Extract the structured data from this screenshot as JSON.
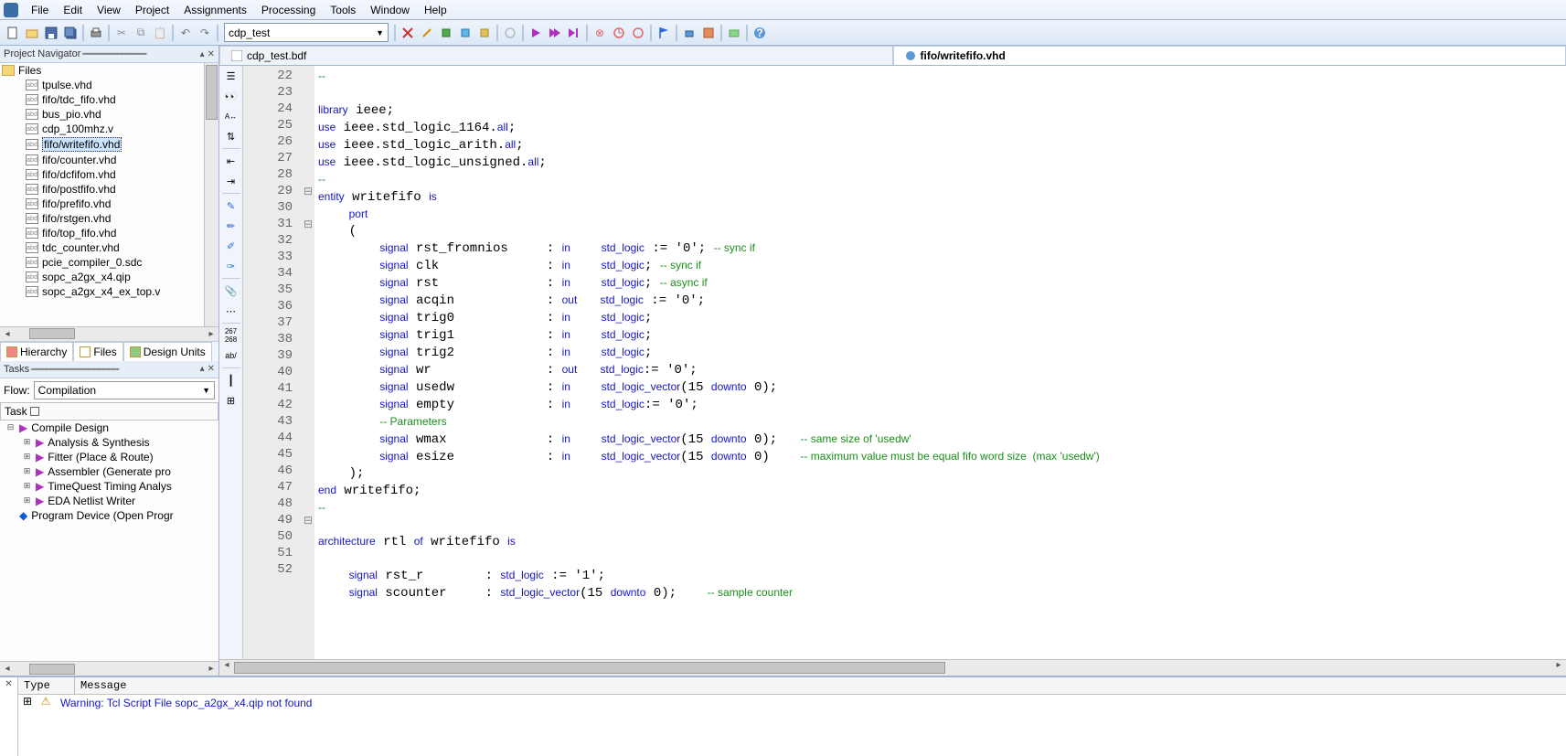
{
  "menu": {
    "items": [
      "File",
      "Edit",
      "View",
      "Project",
      "Assignments",
      "Processing",
      "Tools",
      "Window",
      "Help"
    ]
  },
  "toolbar": {
    "project_sel": "cdp_test"
  },
  "navigator": {
    "title": "Project Navigator",
    "root": "Files",
    "files": [
      "tpulse.vhd",
      "fifo/tdc_fifo.vhd",
      "bus_pio.vhd",
      "cdp_100mhz.v",
      "fifo/writefifo.vhd",
      "fifo/counter.vhd",
      "fifo/dcfifom.vhd",
      "fifo/postfifo.vhd",
      "fifo/prefifo.vhd",
      "fifo/rstgen.vhd",
      "fifo/top_fifo.vhd",
      "tdc_counter.vhd",
      "pcie_compiler_0.sdc",
      "sopc_a2gx_x4.qip",
      "sopc_a2gx_x4_ex_top.v"
    ],
    "selected": "fifo/writefifo.vhd",
    "tabs": [
      "Hierarchy",
      "Files",
      "Design Units"
    ]
  },
  "tasks": {
    "title": "Tasks",
    "flow_label": "Flow:",
    "flow_value": "Compilation",
    "task_header": "Task",
    "tree": [
      {
        "label": "Compile Design",
        "indent": 0,
        "color": "purple",
        "exp": "⊟"
      },
      {
        "label": "Analysis & Synthesis",
        "indent": 1,
        "color": "purple",
        "exp": "⊞"
      },
      {
        "label": "Fitter (Place & Route)",
        "indent": 1,
        "color": "purple",
        "exp": "⊞"
      },
      {
        "label": "Assembler (Generate pro",
        "indent": 1,
        "color": "purple",
        "exp": "⊞"
      },
      {
        "label": "TimeQuest Timing Analys",
        "indent": 1,
        "color": "purple",
        "exp": "⊞"
      },
      {
        "label": "EDA Netlist Writer",
        "indent": 1,
        "color": "purple",
        "exp": "⊞"
      },
      {
        "label": "Program Device (Open Progr",
        "indent": 0,
        "color": "blue",
        "exp": ""
      }
    ]
  },
  "editor": {
    "tabs": [
      {
        "label": "cdp_test.bdf",
        "active": false,
        "icon": "bdf"
      },
      {
        "label": "fifo/writefifo.vhd",
        "active": true,
        "icon": "vhd"
      }
    ],
    "lines": [
      {
        "n": 22,
        "f": "",
        "h": "<span class='cmt'>--</span>"
      },
      {
        "n": 23,
        "f": "",
        "h": ""
      },
      {
        "n": 24,
        "f": "",
        "h": "<span class='kw'>library</span> ieee;"
      },
      {
        "n": 25,
        "f": "",
        "h": "<span class='kw'>use</span> ieee.std_logic_1164.<span class='kw'>all</span>;"
      },
      {
        "n": 26,
        "f": "",
        "h": "<span class='kw'>use</span> ieee.std_logic_arith.<span class='kw'>all</span>;"
      },
      {
        "n": 27,
        "f": "",
        "h": "<span class='kw'>use</span> ieee.std_logic_unsigned.<span class='kw'>all</span>;"
      },
      {
        "n": 28,
        "f": "",
        "h": "<span class='cmt'>--</span>"
      },
      {
        "n": 29,
        "f": "⊟",
        "h": "<span class='kw'>entity</span> writefifo <span class='kw'>is</span>"
      },
      {
        "n": 30,
        "f": "",
        "h": "    <span class='kw'>port</span>"
      },
      {
        "n": 31,
        "f": "⊟",
        "h": "    ("
      },
      {
        "n": 32,
        "f": "",
        "h": "        <span class='kw'>signal</span> rst_fromnios     : <span class='kw'>in</span>    <span class='typ'>std_logic</span> := '0'; <span class='cmt'>-- sync if</span>"
      },
      {
        "n": 33,
        "f": "",
        "h": "        <span class='kw'>signal</span> clk              : <span class='kw'>in</span>    <span class='typ'>std_logic</span>; <span class='cmt'>-- sync if</span>"
      },
      {
        "n": 34,
        "f": "",
        "h": "        <span class='kw'>signal</span> rst              : <span class='kw'>in</span>    <span class='typ'>std_logic</span>; <span class='cmt'>-- async if</span>"
      },
      {
        "n": 35,
        "f": "",
        "h": "        <span class='kw'>signal</span> acqin            : <span class='kw'>out</span>   <span class='typ'>std_logic</span> := '0';"
      },
      {
        "n": 36,
        "f": "",
        "h": "        <span class='kw'>signal</span> trig0            : <span class='kw'>in</span>    <span class='typ'>std_logic</span>;"
      },
      {
        "n": 37,
        "f": "",
        "h": "        <span class='kw'>signal</span> trig1            : <span class='kw'>in</span>    <span class='typ'>std_logic</span>;"
      },
      {
        "n": 38,
        "f": "",
        "h": "        <span class='kw'>signal</span> trig2            : <span class='kw'>in</span>    <span class='typ'>std_logic</span>;"
      },
      {
        "n": 39,
        "f": "",
        "h": "        <span class='kw'>signal</span> wr               : <span class='kw'>out</span>   <span class='typ'>std_logic</span>:= '0';"
      },
      {
        "n": 40,
        "f": "",
        "h": "        <span class='kw'>signal</span> usedw            : <span class='kw'>in</span>    <span class='typ'>std_logic_vector</span>(15 <span class='kw'>downto</span> 0);"
      },
      {
        "n": 41,
        "f": "",
        "h": "        <span class='kw'>signal</span> empty            : <span class='kw'>in</span>    <span class='typ'>std_logic</span>:= '0';"
      },
      {
        "n": 42,
        "f": "",
        "h": "        <span class='cmt'>-- Parameters</span>"
      },
      {
        "n": 43,
        "f": "",
        "h": "        <span class='kw'>signal</span> wmax             : <span class='kw'>in</span>    <span class='typ'>std_logic_vector</span>(15 <span class='kw'>downto</span> 0);   <span class='cmt'>-- same size of 'usedw'</span>"
      },
      {
        "n": 44,
        "f": "",
        "h": "        <span class='kw'>signal</span> esize            : <span class='kw'>in</span>    <span class='typ'>std_logic_vector</span>(15 <span class='kw'>downto</span> 0)    <span class='cmt'>-- maximum value must be equal fifo word size  (max 'usedw')</span>"
      },
      {
        "n": 45,
        "f": "",
        "h": "    );"
      },
      {
        "n": 46,
        "f": "",
        "h": "<span class='kw'>end</span> writefifo;"
      },
      {
        "n": 47,
        "f": "",
        "h": "<span class='cmt'>--</span>"
      },
      {
        "n": 48,
        "f": "",
        "h": ""
      },
      {
        "n": 49,
        "f": "⊟",
        "h": "<span class='kw'>architecture</span> rtl <span class='kw'>of</span> writefifo <span class='kw'>is</span>"
      },
      {
        "n": 50,
        "f": "",
        "h": ""
      },
      {
        "n": 51,
        "f": "",
        "h": "    <span class='kw'>signal</span> rst_r        : <span class='typ'>std_logic</span> := '1';"
      },
      {
        "n": 52,
        "f": "",
        "h": "    <span class='kw'>signal</span> scounter     : <span class='typ'>std_logic_vector</span>(15 <span class='kw'>downto</span> 0);    <span class='cmt'>-- sample counter</span>"
      }
    ]
  },
  "messages": {
    "head_type": "Type",
    "head_msg": "Message",
    "rows": [
      {
        "icon": "warn",
        "text": "Warning: Tcl Script File sopc_a2gx_x4.qip not found"
      }
    ]
  }
}
